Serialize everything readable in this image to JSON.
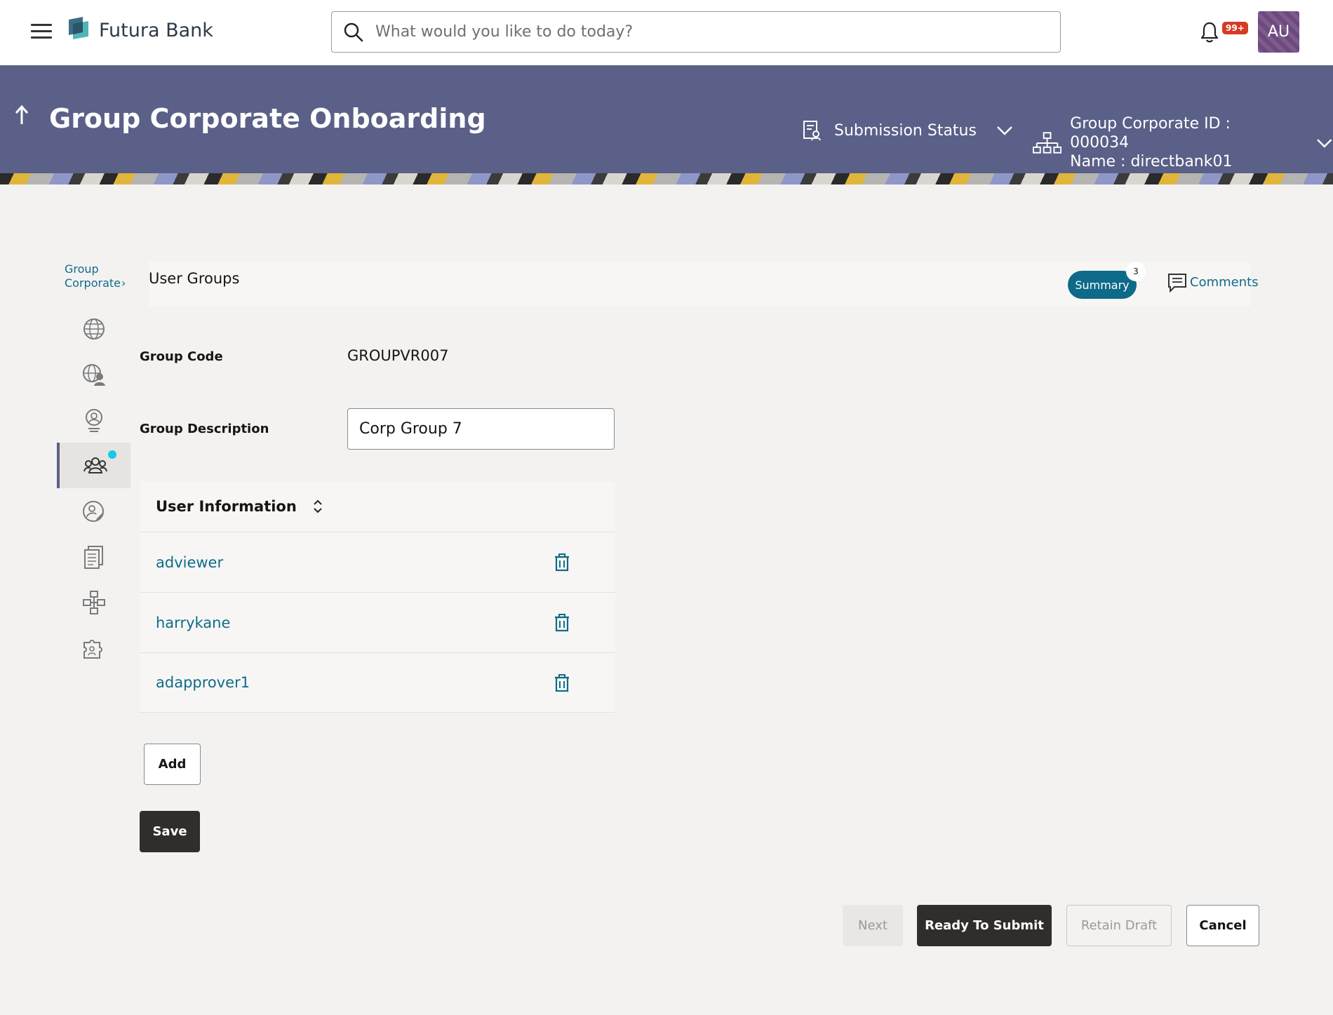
{
  "header": {
    "brand": "Futura Bank",
    "search_placeholder": "What would you like to do today?",
    "notification_count": "99+",
    "avatar_initials": "AU"
  },
  "banner": {
    "title": "Group Corporate Onboarding",
    "submission_status": "Submission Status",
    "corporate_id": "Group Corporate ID : 000034",
    "corporate_name": "Name : directbank01"
  },
  "breadcrumb": {
    "line1": "Group",
    "line2": "Corporate"
  },
  "sidenav": {
    "items": [
      {
        "icon": "globe-icon"
      },
      {
        "icon": "globe-user-icon"
      },
      {
        "icon": "user-badge-icon"
      },
      {
        "icon": "user-group-icon",
        "active": true
      },
      {
        "icon": "user-edit-icon"
      },
      {
        "icon": "documents-icon"
      },
      {
        "icon": "workflow-icon"
      },
      {
        "icon": "puzzle-users-icon"
      }
    ]
  },
  "section": {
    "title": "User Groups",
    "summary_label": "Summary",
    "summary_count": "3",
    "comments_label": "Comments"
  },
  "form": {
    "group_code_label": "Group Code",
    "group_code_value": "GROUPVR007",
    "group_description_label": "Group Description",
    "group_description_value": "Corp Group 7"
  },
  "user_table": {
    "header": "User Information",
    "rows": [
      {
        "username": "adviewer"
      },
      {
        "username": "harrykane"
      },
      {
        "username": "adapprover1"
      }
    ]
  },
  "buttons": {
    "add": "Add",
    "save": "Save",
    "next": "Next",
    "ready_to_submit": "Ready To Submit",
    "retain_draft": "Retain Draft",
    "cancel": "Cancel"
  },
  "colors": {
    "banner": "#5a6087",
    "link": "#0f6c89",
    "dark_button": "#312d2a",
    "notification": "#d63b25",
    "active_dot": "#19c8e6"
  }
}
